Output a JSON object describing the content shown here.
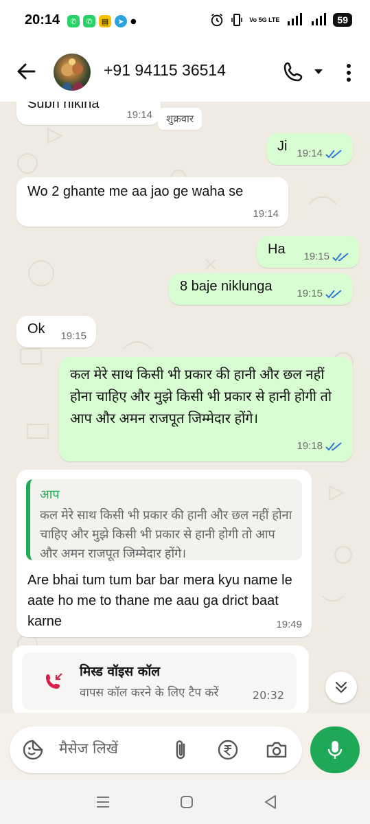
{
  "status_bar": {
    "time": "20:14",
    "network_label": "Vo 5G LTE",
    "battery": "59"
  },
  "header": {
    "contact": "+91 94115 36514"
  },
  "chat": {
    "day_chip": "शुक्रवार",
    "messages": [
      {
        "direction": "in",
        "text": "Subh niklna",
        "time": "19:14"
      },
      {
        "direction": "out",
        "text": "Ji",
        "time": "19:14",
        "read": true
      },
      {
        "direction": "in",
        "text": "Wo 2 ghante me aa jao ge waha se",
        "time": "19:14"
      },
      {
        "direction": "out",
        "text": "Ha",
        "time": "19:15",
        "read": true
      },
      {
        "direction": "out",
        "text": "8 baje niklunga",
        "time": "19:15",
        "read": true
      },
      {
        "direction": "in",
        "text": "Ok",
        "time": "19:15"
      },
      {
        "direction": "out",
        "text": "कल मेरे साथ किसी भी प्रकार की हानी और छल नहीं होना चाहिए और मुझे किसी भी प्रकार से हानी होगी तो आप और अमन राजपूत जिम्मेदार होंगे।",
        "time": "19:18",
        "read": true
      },
      {
        "direction": "in",
        "reply": {
          "sender": "आप",
          "text": "कल मेरे साथ किसी भी प्रकार की हानी और छल  नहीं होना चाहिए और मुझे किसी भी प्रकार से हानी होगी तो आप और अमन राजपूत जिम्मेदार होंगे।"
        },
        "text": "Are bhai tum tum bar bar mera kyu name le aate ho me to thane me aau ga drict baat karne",
        "time": "19:49"
      }
    ],
    "missed_call": {
      "title": "मिस्ड  वॉइस कॉल",
      "subtitle": "वापस कॉल करने के लिए टैप करें",
      "time": "20:32"
    }
  },
  "composer": {
    "placeholder": "मैसेज लिखें"
  },
  "colors": {
    "accent": "#1fa855",
    "outgoing_bubble": "#d9fdd3",
    "incoming_bubble": "#ffffff",
    "read_ticks": "#2f78d6",
    "missed_call": "#d6224b"
  }
}
